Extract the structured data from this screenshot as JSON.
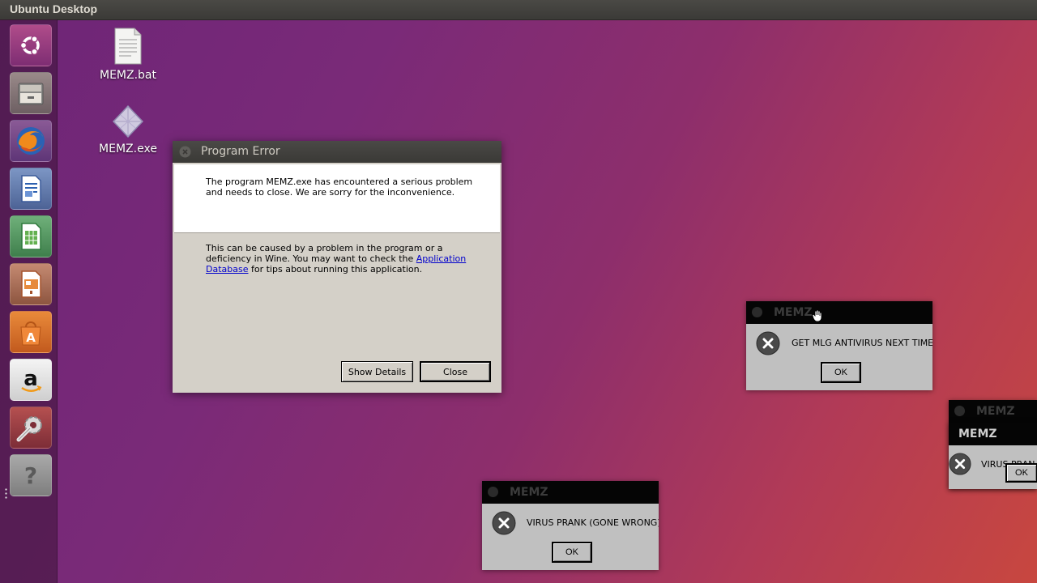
{
  "top_panel": {
    "title": "Ubuntu Desktop"
  },
  "launcher": {
    "items": [
      {
        "name": "ubuntu-dash-icon"
      },
      {
        "name": "files-icon"
      },
      {
        "name": "firefox-icon"
      },
      {
        "name": "libreoffice-writer-icon"
      },
      {
        "name": "libreoffice-calc-icon"
      },
      {
        "name": "libreoffice-impress-icon"
      },
      {
        "name": "software-center-icon"
      },
      {
        "name": "amazon-icon"
      },
      {
        "name": "system-settings-icon"
      },
      {
        "name": "help-icon"
      }
    ]
  },
  "desktop_icons": [
    {
      "label": "MEMZ.bat",
      "icon": "text-file-icon"
    },
    {
      "label": "MEMZ.exe",
      "icon": "wine-exe-icon"
    }
  ],
  "program_error": {
    "title": "Program Error",
    "message": "The program MEMZ.exe has encountered a serious problem and needs to close. We are sorry for the inconvenience.",
    "info_before": "This can be caused by a problem in the program or a deficiency in Wine. You may want to check the ",
    "link": "Application Database",
    "info_after": " for tips about running this application.",
    "show_details_label": "Show Details",
    "close_label": "Close"
  },
  "memz_boxes": [
    {
      "title": "MEMZ",
      "message": "GET MLG ANTIVIRUS NEXT TIME",
      "ok_label": "OK"
    },
    {
      "title": "MEMZ",
      "message": "VIRUS PRANK (GONE WRONG)",
      "ok_label": "OK"
    },
    {
      "title": "MEMZ",
      "message": "VIRUS PRAN",
      "ok_label": "OK"
    },
    {
      "title": "MEMZ"
    }
  ],
  "colors": {
    "link": "#0000cc",
    "titlebar": "#3a3936",
    "memz_titlebar": "#050505"
  }
}
